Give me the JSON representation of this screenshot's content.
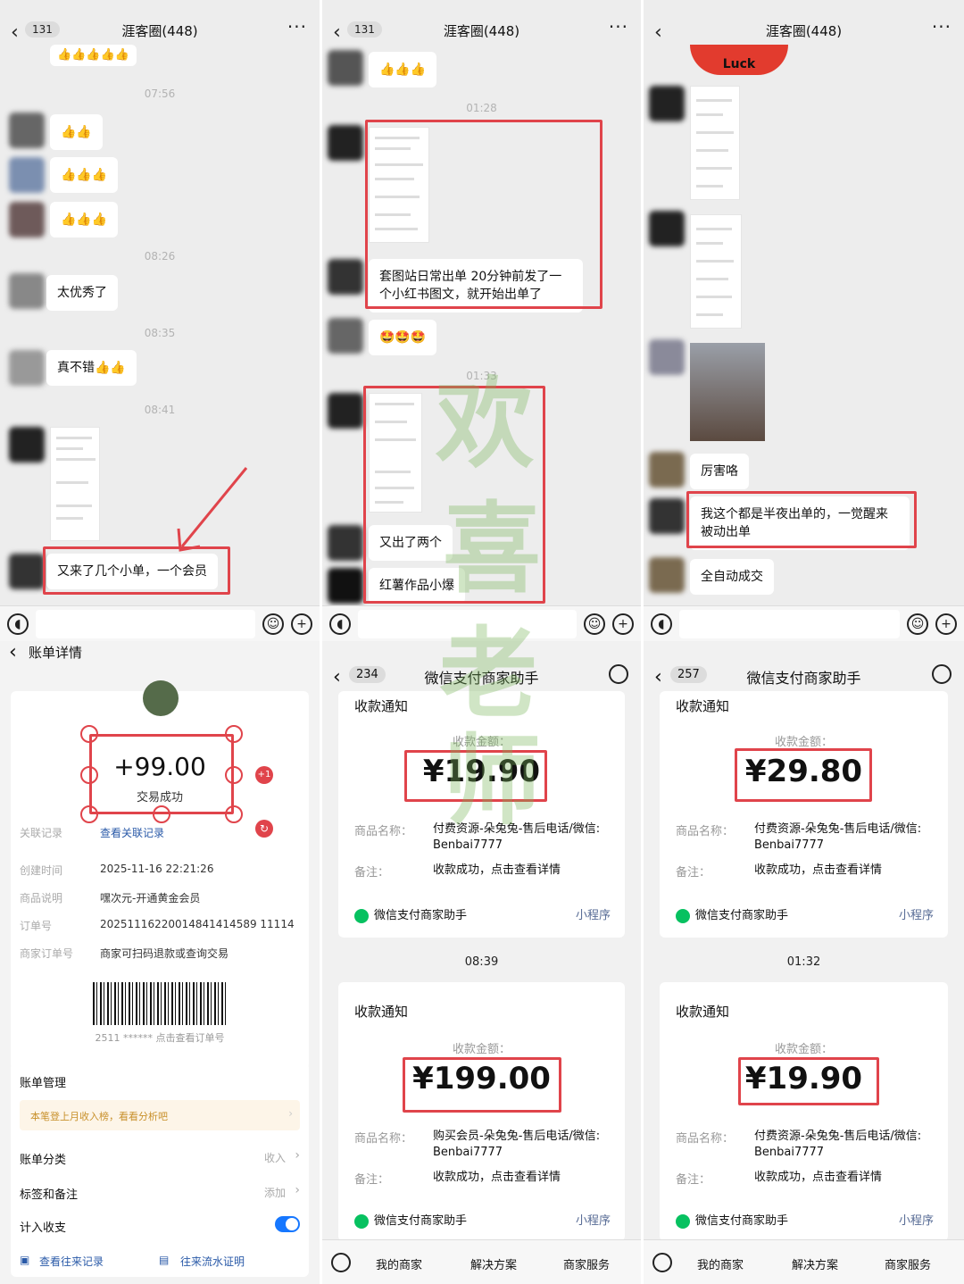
{
  "chat_panels": [
    {
      "badge": "131",
      "title": "涯客圈(448)",
      "messages": {
        "t1": "07:56",
        "t2": "08:26",
        "m_great": "太优秀了",
        "t3": "08:35",
        "m_notbad": "真不错👍👍",
        "t4": "08:41",
        "m_orders": "又来了几个小单，一个会员"
      }
    },
    {
      "badge": "131",
      "title": "涯客圈(448)",
      "messages": {
        "t1": "01:28",
        "m_taotu": "套图站日常出单 20分钟前发了一个小红书图文，就开始出单了",
        "t2": "01:33",
        "m_two": "又出了两个",
        "m_hot": "红薯作品小爆"
      }
    },
    {
      "title": "涯客圈(448)",
      "messages": {
        "m_luck": "Luck",
        "m_amazing": "厉害咯",
        "m_night": "我这个都是半夜出单的，一觉醒来被动出单",
        "m_auto": "全自动成交"
      }
    }
  ],
  "bill": {
    "title": "账单详情",
    "amount": "+99.00",
    "status": "交易成功",
    "rows": [
      {
        "k": "关联记录",
        "v": "查看关联记录"
      },
      {
        "k": "创建时间",
        "v": "2025-11-16 22:21:26"
      },
      {
        "k": "商品说明",
        "v": "嘿次元-开通黄金会员"
      },
      {
        "k": "订单号",
        "v": "20251116220014841414589 11114"
      },
      {
        "k": "商家订单号",
        "v": "商家可扫码退款或查询交易"
      }
    ],
    "barcode_caption": "2511 ****** 点击查看订单号",
    "manage_title": "账单管理",
    "tip": "本笔登上月收入榜，看看分析吧",
    "category_label": "账单分类",
    "category_value": "收入",
    "tag_label": "标签和备注",
    "tag_value": "添加",
    "count_label": "计入收支",
    "link_history": "查看往来记录",
    "link_proof": "往来流水证明"
  },
  "wxpay_panels": [
    {
      "badge": "234",
      "title": "微信支付商家助手",
      "cards": [
        {
          "ctitle": "收款通知",
          "lbl": "收款金额：",
          "amount": "¥19.90",
          "k1": "商品名称：",
          "v1": "付费资源-朵兔兔-售后电话/微信: Benbai7777",
          "k2": "备注：",
          "v2": "收款成功，点击查看详情",
          "foot": "微信支付商家助手",
          "mini": "小程序"
        },
        {
          "ctitle": "收款通知",
          "lbl": "收款金额：",
          "amount": "¥199.00",
          "k1": "商品名称：",
          "v1": "购买会员-朵兔兔-售后电话/微信: Benbai7777",
          "k2": "备注：",
          "v2": "收款成功，点击查看详情",
          "foot": "微信支付商家助手",
          "mini": "小程序"
        }
      ],
      "midtime": "08:39",
      "tabs": [
        "我的商家",
        "解决方案",
        "商家服务"
      ]
    },
    {
      "badge": "257",
      "title": "微信支付商家助手",
      "cards": [
        {
          "ctitle": "收款通知",
          "lbl": "收款金额：",
          "amount": "¥29.80",
          "k1": "商品名称：",
          "v1": "付费资源-朵兔兔-售后电话/微信: Benbai7777",
          "k2": "备注：",
          "v2": "收款成功，点击查看详情",
          "foot": "微信支付商家助手",
          "mini": "小程序"
        },
        {
          "ctitle": "收款通知",
          "lbl": "收款金额：",
          "amount": "¥19.90",
          "k1": "商品名称：",
          "v1": "付费资源-朵兔兔-售后电话/微信: Benbai7777",
          "k2": "备注：",
          "v2": "收款成功，点击查看详情",
          "foot": "微信支付商家助手",
          "mini": "小程序"
        }
      ],
      "midtime": "01:32",
      "tabs": [
        "我的商家",
        "解决方案",
        "商家服务"
      ]
    }
  ],
  "watermark": [
    "欢",
    "喜",
    "老",
    "师"
  ],
  "colors": {
    "highlight": "#e0444b",
    "wechat_green": "#07c160",
    "link": "#576b95",
    "toggle": "#1677ff"
  }
}
